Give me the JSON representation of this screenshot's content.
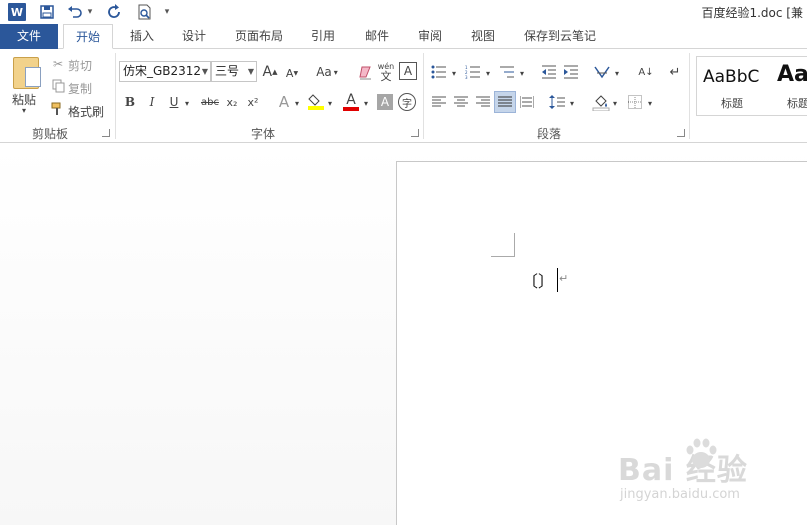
{
  "titlebar": {
    "title": "百度经验1.doc [兼",
    "undo_arrow": "▾",
    "customize": "▾"
  },
  "tabs": [
    {
      "label": "文件"
    },
    {
      "label": "开始"
    },
    {
      "label": "插入"
    },
    {
      "label": "设计"
    },
    {
      "label": "页面布局"
    },
    {
      "label": "引用"
    },
    {
      "label": "邮件"
    },
    {
      "label": "审阅"
    },
    {
      "label": "视图"
    },
    {
      "label": "保存到云笔记"
    }
  ],
  "clipboard": {
    "paste_label": "粘贴",
    "cut_label": "剪切",
    "copy_label": "复制",
    "format_painter_label": "格式刷",
    "group_label": "剪贴板"
  },
  "font": {
    "font_name": "仿宋_GB2312",
    "font_size": "三号",
    "grow": "A",
    "shrink": "A",
    "change_case": "Aa",
    "phonetic_top": "wén",
    "phonetic_bottom": "文",
    "char_border": "A",
    "bold": "B",
    "italic": "I",
    "underline": "U",
    "strikethrough": "abc",
    "subscript": "x₂",
    "superscript": "x²",
    "text_effect": "A",
    "font_color": "A",
    "char_shading": "A",
    "enclose": "字",
    "group_label": "字体"
  },
  "paragraph": {
    "sort": "A↓",
    "group_label": "段落"
  },
  "styles": {
    "style1_preview": "AaBbC",
    "style1_name": "标题",
    "style2_preview": "Aa",
    "style2_name": "标题"
  },
  "document": {
    "text": "〔〕",
    "para_mark": "↵"
  },
  "watermark": {
    "logo": "Bai  经验",
    "url": "jingyan.baidu.com"
  },
  "colors": {
    "accent": "#2b579a",
    "highlight": "#ffff00",
    "font_color": "#e00000",
    "active_align": "#c5d5ea"
  }
}
